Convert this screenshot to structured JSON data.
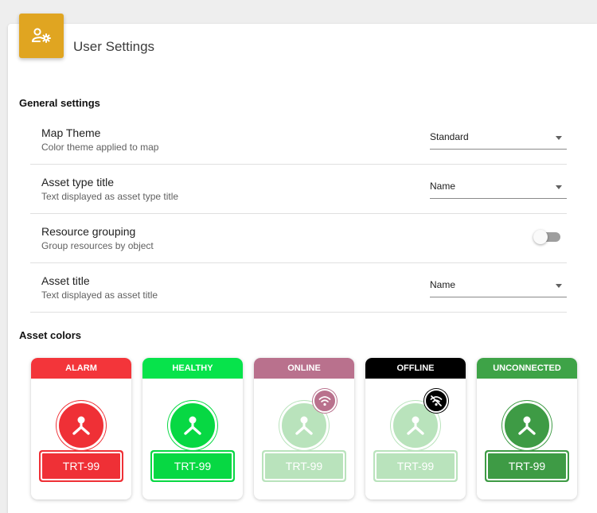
{
  "header": {
    "title": "User Settings",
    "icon": "user-settings-icon"
  },
  "general": {
    "title": "General settings",
    "rows": [
      {
        "name": "Map Theme",
        "description": "Color theme applied to map",
        "control": "select",
        "value": "Standard"
      },
      {
        "name": "Asset type title",
        "description": "Text displayed as asset type title",
        "control": "select",
        "value": "Name"
      },
      {
        "name": "Resource grouping",
        "description": "Group resources by object",
        "control": "toggle",
        "enabled": false
      },
      {
        "name": "Asset title",
        "description": "Text displayed as asset title",
        "control": "select",
        "value": "Name"
      }
    ]
  },
  "asset_colors": {
    "title": "Asset colors",
    "cards": [
      {
        "status": "ALARM",
        "label": "TRT-99",
        "header_color": "#f3353a",
        "circle_color": "#ef3036",
        "label_color": "#ef3036",
        "faded": false,
        "badge": null
      },
      {
        "status": "HEALTHY",
        "label": "TRT-99",
        "header_color": "#07e34b",
        "circle_color": "#07d843",
        "label_color": "#07d843",
        "faded": false,
        "badge": null
      },
      {
        "status": "ONLINE",
        "label": "TRT-99",
        "header_color": "#b9718d",
        "circle_color": "#b9e3bc",
        "label_color": "#b9e3bc",
        "faded": true,
        "badge": "wifi-icon",
        "badge_color": "#b9718d"
      },
      {
        "status": "OFFLINE",
        "label": "TRT-99",
        "header_color": "#000000",
        "circle_color": "#b9e3bc",
        "label_color": "#b9e3bc",
        "faded": true,
        "badge": "wifi-off-icon",
        "badge_color": "#000000"
      },
      {
        "status": "UNCONNECTED",
        "label": "TRT-99",
        "header_color": "#3ea347",
        "circle_color": "#3e9b45",
        "label_color": "#3e9b45",
        "faded": false,
        "badge": null
      }
    ]
  }
}
